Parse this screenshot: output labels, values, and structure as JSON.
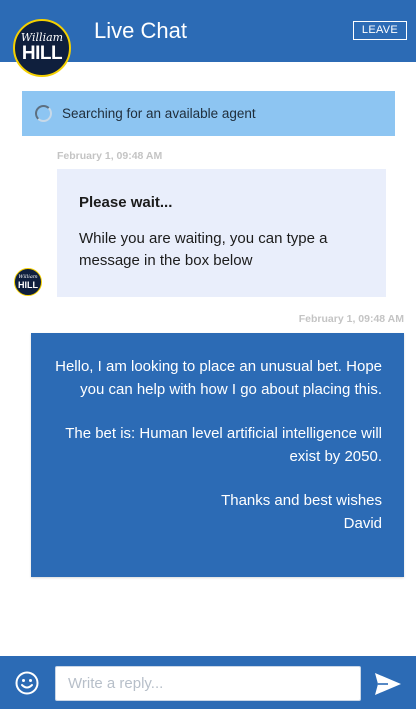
{
  "header": {
    "logo_top": "William",
    "logo_bottom": "HILL",
    "title": "Live Chat",
    "leave_label": "LEAVE"
  },
  "status": {
    "text": "Searching for an available agent"
  },
  "messages": [
    {
      "timestamp": "February 1, 09:48 AM",
      "title": "Please wait...",
      "body": "While you are waiting, you can type a message in the box below",
      "avatar_top": "William",
      "avatar_bottom": "HILL"
    },
    {
      "timestamp": "February 1, 09:48 AM",
      "paragraphs": [
        "Hello, I am looking to place an unusual bet. Hope you can help with how I go about placing this.",
        "The bet is: Human level artificial intelligence will exist by 2050.",
        "Thanks and best wishes\nDavid"
      ]
    }
  ],
  "composer": {
    "placeholder": "Write a reply...",
    "value": ""
  },
  "icons": {
    "emoji": "smiley-face-icon",
    "send": "send-arrow-icon"
  },
  "colors": {
    "primary": "#2c6bb5",
    "status_bg": "#8dc5f2",
    "agent_bubble": "#e9eefb",
    "logo_ring": "#f5d000"
  }
}
